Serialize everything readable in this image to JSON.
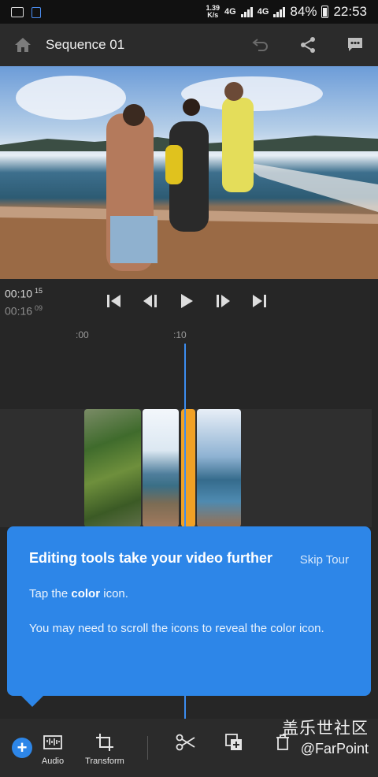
{
  "status_bar": {
    "net_speed_value": "1.39",
    "net_speed_unit": "K/s",
    "network": "4G",
    "network2": "4G",
    "battery": "84%",
    "time": "22:53"
  },
  "app_bar": {
    "title": "Sequence 01"
  },
  "player": {
    "current_time": "00:10",
    "current_frames": "15",
    "total_time": "00:16",
    "total_frames": "09"
  },
  "timeline": {
    "ruler_labels": [
      ":00",
      ":10"
    ]
  },
  "tooltip": {
    "title": "Editing tools take your video further",
    "skip": "Skip Tour",
    "line1_prefix": "Tap the ",
    "line1_bold": "color",
    "line1_suffix": " icon.",
    "line2": "You may need to scroll the icons to reveal the color icon."
  },
  "toolbar": {
    "add_label": "+",
    "audio_label": "Audio",
    "transform_label": "Transform"
  },
  "watermark": {
    "chinese": "盖乐世社区",
    "handle": "@FarPoint"
  },
  "colors": {
    "accent": "#2d86e8",
    "playhead": "#3c8df0",
    "selected_clip": "#f1a126"
  }
}
